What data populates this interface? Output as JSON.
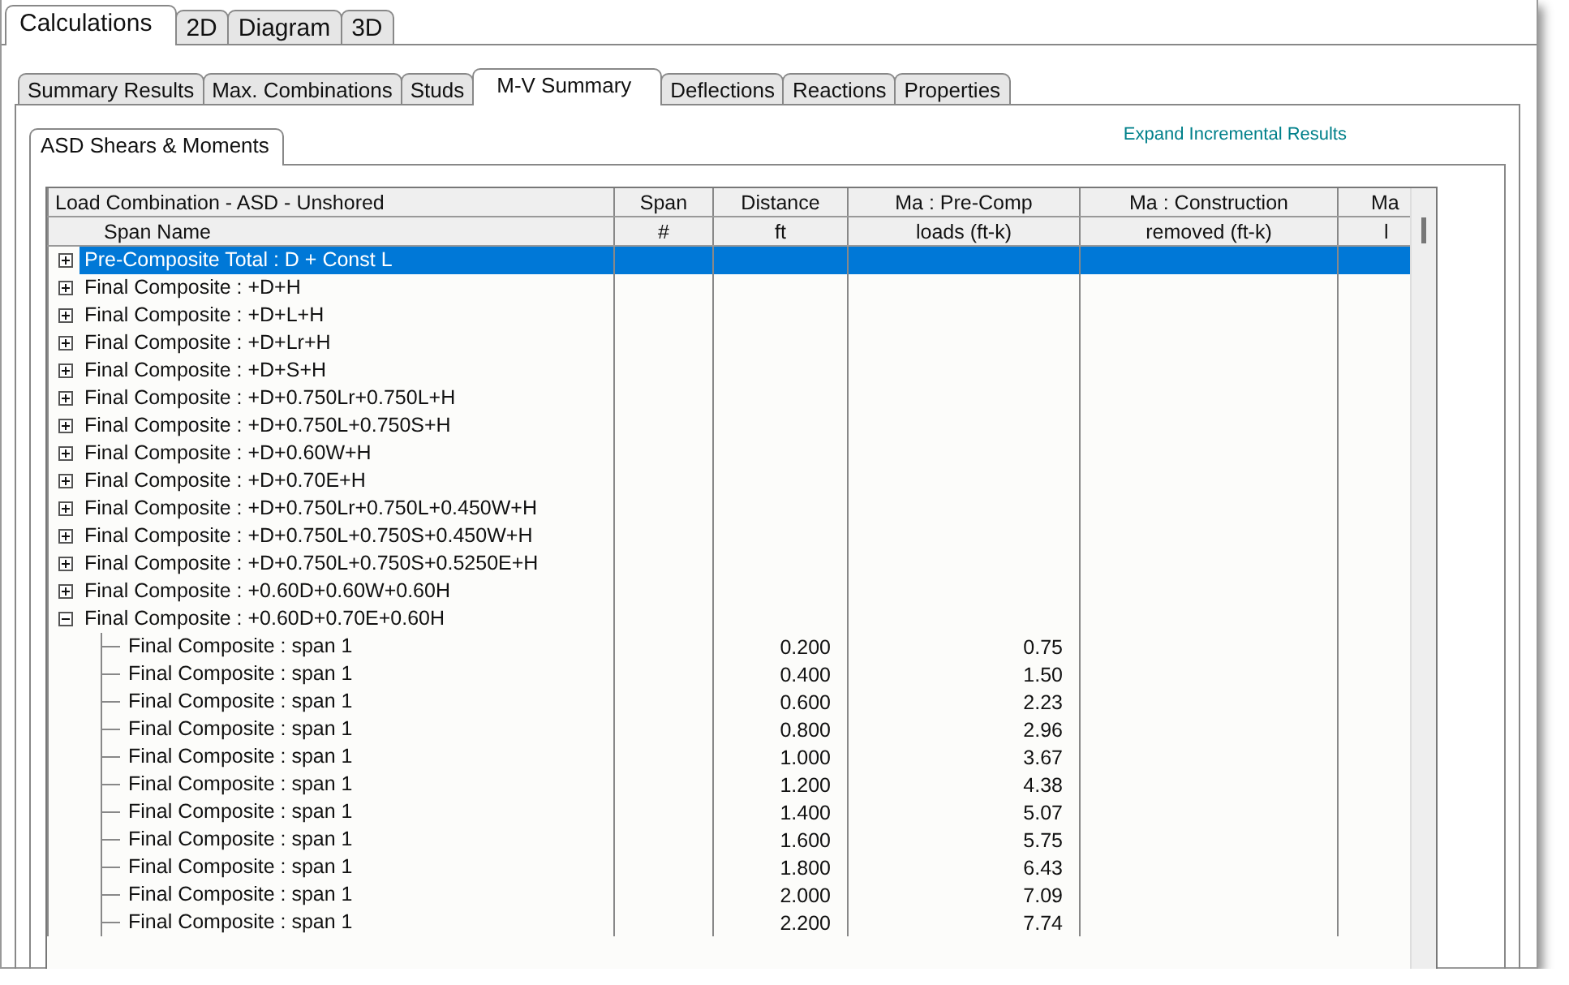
{
  "tabs": [
    {
      "label": "Calculations",
      "selected": true
    },
    {
      "label": "2D",
      "selected": false
    },
    {
      "label": "Diagram",
      "selected": false
    },
    {
      "label": "3D",
      "selected": false
    }
  ],
  "subtabs": [
    {
      "label": "Summary Results",
      "selected": false
    },
    {
      "label": "Max. Combinations",
      "selected": false
    },
    {
      "label": "Studs",
      "selected": false
    },
    {
      "label": "M-V Summary",
      "selected": true
    },
    {
      "label": "Deflections",
      "selected": false
    },
    {
      "label": "Reactions",
      "selected": false
    },
    {
      "label": "Properties",
      "selected": false
    }
  ],
  "inner_tabs": [
    {
      "label": "ASD Shears & Moments",
      "selected": true
    }
  ],
  "link": "Expand Incremental Results",
  "table": {
    "columns": [
      {
        "label": "Load Combination - ASD - Unshored",
        "sublabel": "Span Name"
      },
      {
        "label": "Span",
        "sublabel": "#"
      },
      {
        "label": "Distance",
        "sublabel": "ft"
      },
      {
        "label": "Ma : Pre-Comp",
        "sublabel": "loads    (ft-k)"
      },
      {
        "label": "Ma : Construction",
        "sublabel": "removed    (ft-k)"
      },
      {
        "label": "Ma",
        "sublabel": "l"
      }
    ],
    "rows": [
      {
        "name": "Pre-Composite Total : D + Const L",
        "expanded": false,
        "selected": true
      },
      {
        "name": "Final Composite : +D+H",
        "expanded": false,
        "selected": false
      },
      {
        "name": "Final Composite : +D+L+H",
        "expanded": false,
        "selected": false
      },
      {
        "name": "Final Composite : +D+Lr+H",
        "expanded": false,
        "selected": false
      },
      {
        "name": "Final Composite : +D+S+H",
        "expanded": false,
        "selected": false
      },
      {
        "name": "Final Composite : +D+0.750Lr+0.750L+H",
        "expanded": false,
        "selected": false
      },
      {
        "name": "Final Composite : +D+0.750L+0.750S+H",
        "expanded": false,
        "selected": false
      },
      {
        "name": "Final Composite : +D+0.60W+H",
        "expanded": false,
        "selected": false
      },
      {
        "name": "Final Composite : +D+0.70E+H",
        "expanded": false,
        "selected": false
      },
      {
        "name": "Final Composite : +D+0.750Lr+0.750L+0.450W+H",
        "expanded": false,
        "selected": false
      },
      {
        "name": "Final Composite : +D+0.750L+0.750S+0.450W+H",
        "expanded": false,
        "selected": false
      },
      {
        "name": "Final Composite : +D+0.750L+0.750S+0.5250E+H",
        "expanded": false,
        "selected": false
      },
      {
        "name": "Final Composite : +0.60D+0.60W+0.60H",
        "expanded": false,
        "selected": false
      },
      {
        "name": "Final Composite : +0.60D+0.70E+0.60H",
        "expanded": true,
        "selected": false,
        "children": [
          {
            "name": "Final Composite : span 1",
            "distance": "0.200",
            "ma_pre_comp": "0.75"
          },
          {
            "name": "Final Composite : span 1",
            "distance": "0.400",
            "ma_pre_comp": "1.50"
          },
          {
            "name": "Final Composite : span 1",
            "distance": "0.600",
            "ma_pre_comp": "2.23"
          },
          {
            "name": "Final Composite : span 1",
            "distance": "0.800",
            "ma_pre_comp": "2.96"
          },
          {
            "name": "Final Composite : span 1",
            "distance": "1.000",
            "ma_pre_comp": "3.67"
          },
          {
            "name": "Final Composite : span 1",
            "distance": "1.200",
            "ma_pre_comp": "4.38"
          },
          {
            "name": "Final Composite : span 1",
            "distance": "1.400",
            "ma_pre_comp": "5.07"
          },
          {
            "name": "Final Composite : span 1",
            "distance": "1.600",
            "ma_pre_comp": "5.75"
          },
          {
            "name": "Final Composite : span 1",
            "distance": "1.800",
            "ma_pre_comp": "6.43"
          },
          {
            "name": "Final Composite : span 1",
            "distance": "2.000",
            "ma_pre_comp": "7.09"
          },
          {
            "name": "Final Composite : span 1",
            "distance": "2.200",
            "ma_pre_comp": "7.74"
          }
        ]
      }
    ]
  }
}
